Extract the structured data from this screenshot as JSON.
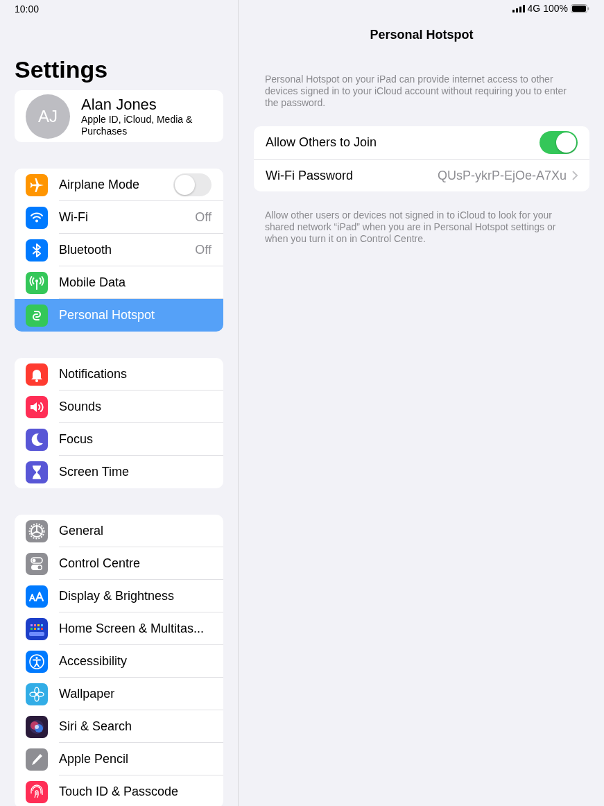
{
  "status_bar": {
    "time": "10:00",
    "network": "4G",
    "battery": "100%"
  },
  "sidebar": {
    "title": "Settings",
    "profile": {
      "initials": "AJ",
      "name": "Alan Jones",
      "subtitle": "Apple ID, iCloud, Media & Purchases"
    },
    "groups": [
      {
        "items": [
          {
            "label": "Airplane Mode",
            "kind": "toggle",
            "on": false,
            "color": "#ff9500",
            "selected": false
          },
          {
            "label": "Wi-Fi",
            "kind": "value",
            "value": "Off",
            "color": "#007aff",
            "selected": false
          },
          {
            "label": "Bluetooth",
            "kind": "value",
            "value": "Off",
            "color": "#007aff",
            "selected": false
          },
          {
            "label": "Mobile Data",
            "kind": "plain",
            "color": "#34c759",
            "selected": false
          },
          {
            "label": "Personal Hotspot",
            "kind": "plain",
            "color": "#34c759",
            "selected": true
          }
        ]
      },
      {
        "items": [
          {
            "label": "Notifications",
            "kind": "plain",
            "color": "#ff3b30",
            "selected": false
          },
          {
            "label": "Sounds",
            "kind": "plain",
            "color": "#ff2d55",
            "selected": false
          },
          {
            "label": "Focus",
            "kind": "plain",
            "color": "#5856d6",
            "selected": false
          },
          {
            "label": "Screen Time",
            "kind": "plain",
            "color": "#5856d6",
            "selected": false
          }
        ]
      },
      {
        "items": [
          {
            "label": "General",
            "kind": "plain",
            "color": "#8e8e93",
            "selected": false
          },
          {
            "label": "Control Centre",
            "kind": "plain",
            "color": "#8e8e93",
            "selected": false
          },
          {
            "label": "Display & Brightness",
            "kind": "plain",
            "color": "#007aff",
            "selected": false
          },
          {
            "label": "Home Screen & Multitas...",
            "kind": "plain",
            "color": "#1c3fc9",
            "selected": false
          },
          {
            "label": "Accessibility",
            "kind": "plain",
            "color": "#007aff",
            "selected": false
          },
          {
            "label": "Wallpaper",
            "kind": "plain",
            "color": "#32ade6",
            "selected": false
          },
          {
            "label": "Siri & Search",
            "kind": "plain",
            "color": "#2a1a3a",
            "selected": false
          },
          {
            "label": "Apple Pencil",
            "kind": "plain",
            "color": "#8e8e93",
            "selected": false
          },
          {
            "label": "Touch ID & Passcode",
            "kind": "plain",
            "color": "#ff2d55",
            "selected": false
          }
        ]
      }
    ]
  },
  "detail": {
    "title": "Personal Hotspot",
    "description": "Personal Hotspot on your iPad can provide internet access to other devices signed in to your iCloud account without requiring you to enter the password.",
    "rows": [
      {
        "label": "Allow Others to Join",
        "kind": "toggle",
        "on": true
      },
      {
        "label": "Wi-Fi Password",
        "kind": "value",
        "value": "QUsP-ykrP-EjOe-A7Xu"
      }
    ],
    "footer": "Allow other users or devices not signed in to iCloud to look for your shared network “iPad” when you are in Personal Hotspot settings or when you turn it on in Control Centre."
  }
}
